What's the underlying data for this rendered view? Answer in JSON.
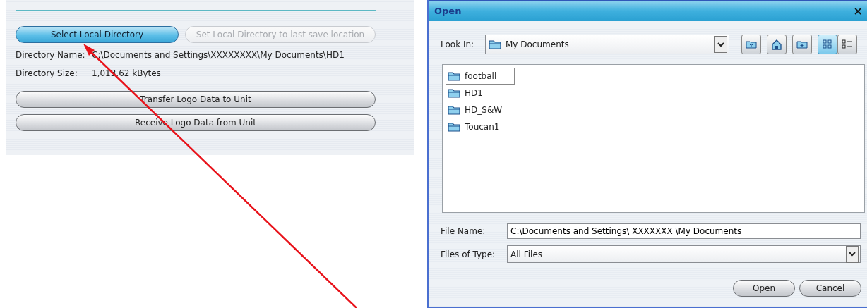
{
  "panel": {
    "buttons": [
      {
        "label": "Select Local Directory",
        "highlighted": true,
        "disabled": false
      },
      {
        "label": "Set Local Directory to last save location",
        "highlighted": false,
        "disabled": true
      }
    ],
    "fields": [
      {
        "label": "Directory Name:",
        "value": "C:\\Documents and Settings\\XXXXXXXX\\My Documents\\HD1"
      },
      {
        "label": "Directory Size:",
        "value": "1,013.62 kBytes"
      }
    ],
    "actions": [
      {
        "label": "Transfer Logo Data to Unit"
      },
      {
        "label": "Receive Logo Data from Unit"
      }
    ]
  },
  "dialog": {
    "title": "Open",
    "close": "×",
    "look_in": {
      "label": "Look In:",
      "value": "My Documents"
    },
    "toolbar": [
      {
        "kind": "up",
        "selected": false
      },
      {
        "kind": "home",
        "selected": false
      },
      {
        "kind": "new-folder",
        "selected": false
      },
      {
        "kind": "list",
        "selected": true
      },
      {
        "kind": "details",
        "selected": false
      }
    ],
    "files": [
      {
        "name": "football",
        "selected": true
      },
      {
        "name": "HD1",
        "selected": false
      },
      {
        "name": "HD_S&W",
        "selected": false
      },
      {
        "name": "Toucan1",
        "selected": false
      }
    ],
    "file_name": {
      "label": "File Name:",
      "value": "C:\\Documents and Settings\\ XXXXXXX \\My Documents"
    },
    "file_type": {
      "label": "Files of Type:",
      "value": "All Files"
    },
    "buttons": [
      "Open",
      "Cancel"
    ]
  }
}
